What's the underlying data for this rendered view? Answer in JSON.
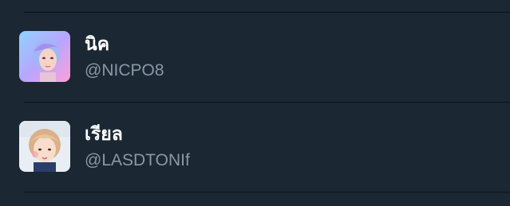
{
  "colors": {
    "background": "#1b2733",
    "divider": "#0b1015",
    "name_text": "#ffffff",
    "handle_text": "#8899a6"
  },
  "accounts": [
    {
      "display_name": "นิค",
      "handle": "@NICPO8",
      "avatar_icon": "user-avatar-photo"
    },
    {
      "display_name": "เรียล",
      "handle": "@LASDTONIf",
      "avatar_icon": "user-avatar-photo"
    }
  ]
}
